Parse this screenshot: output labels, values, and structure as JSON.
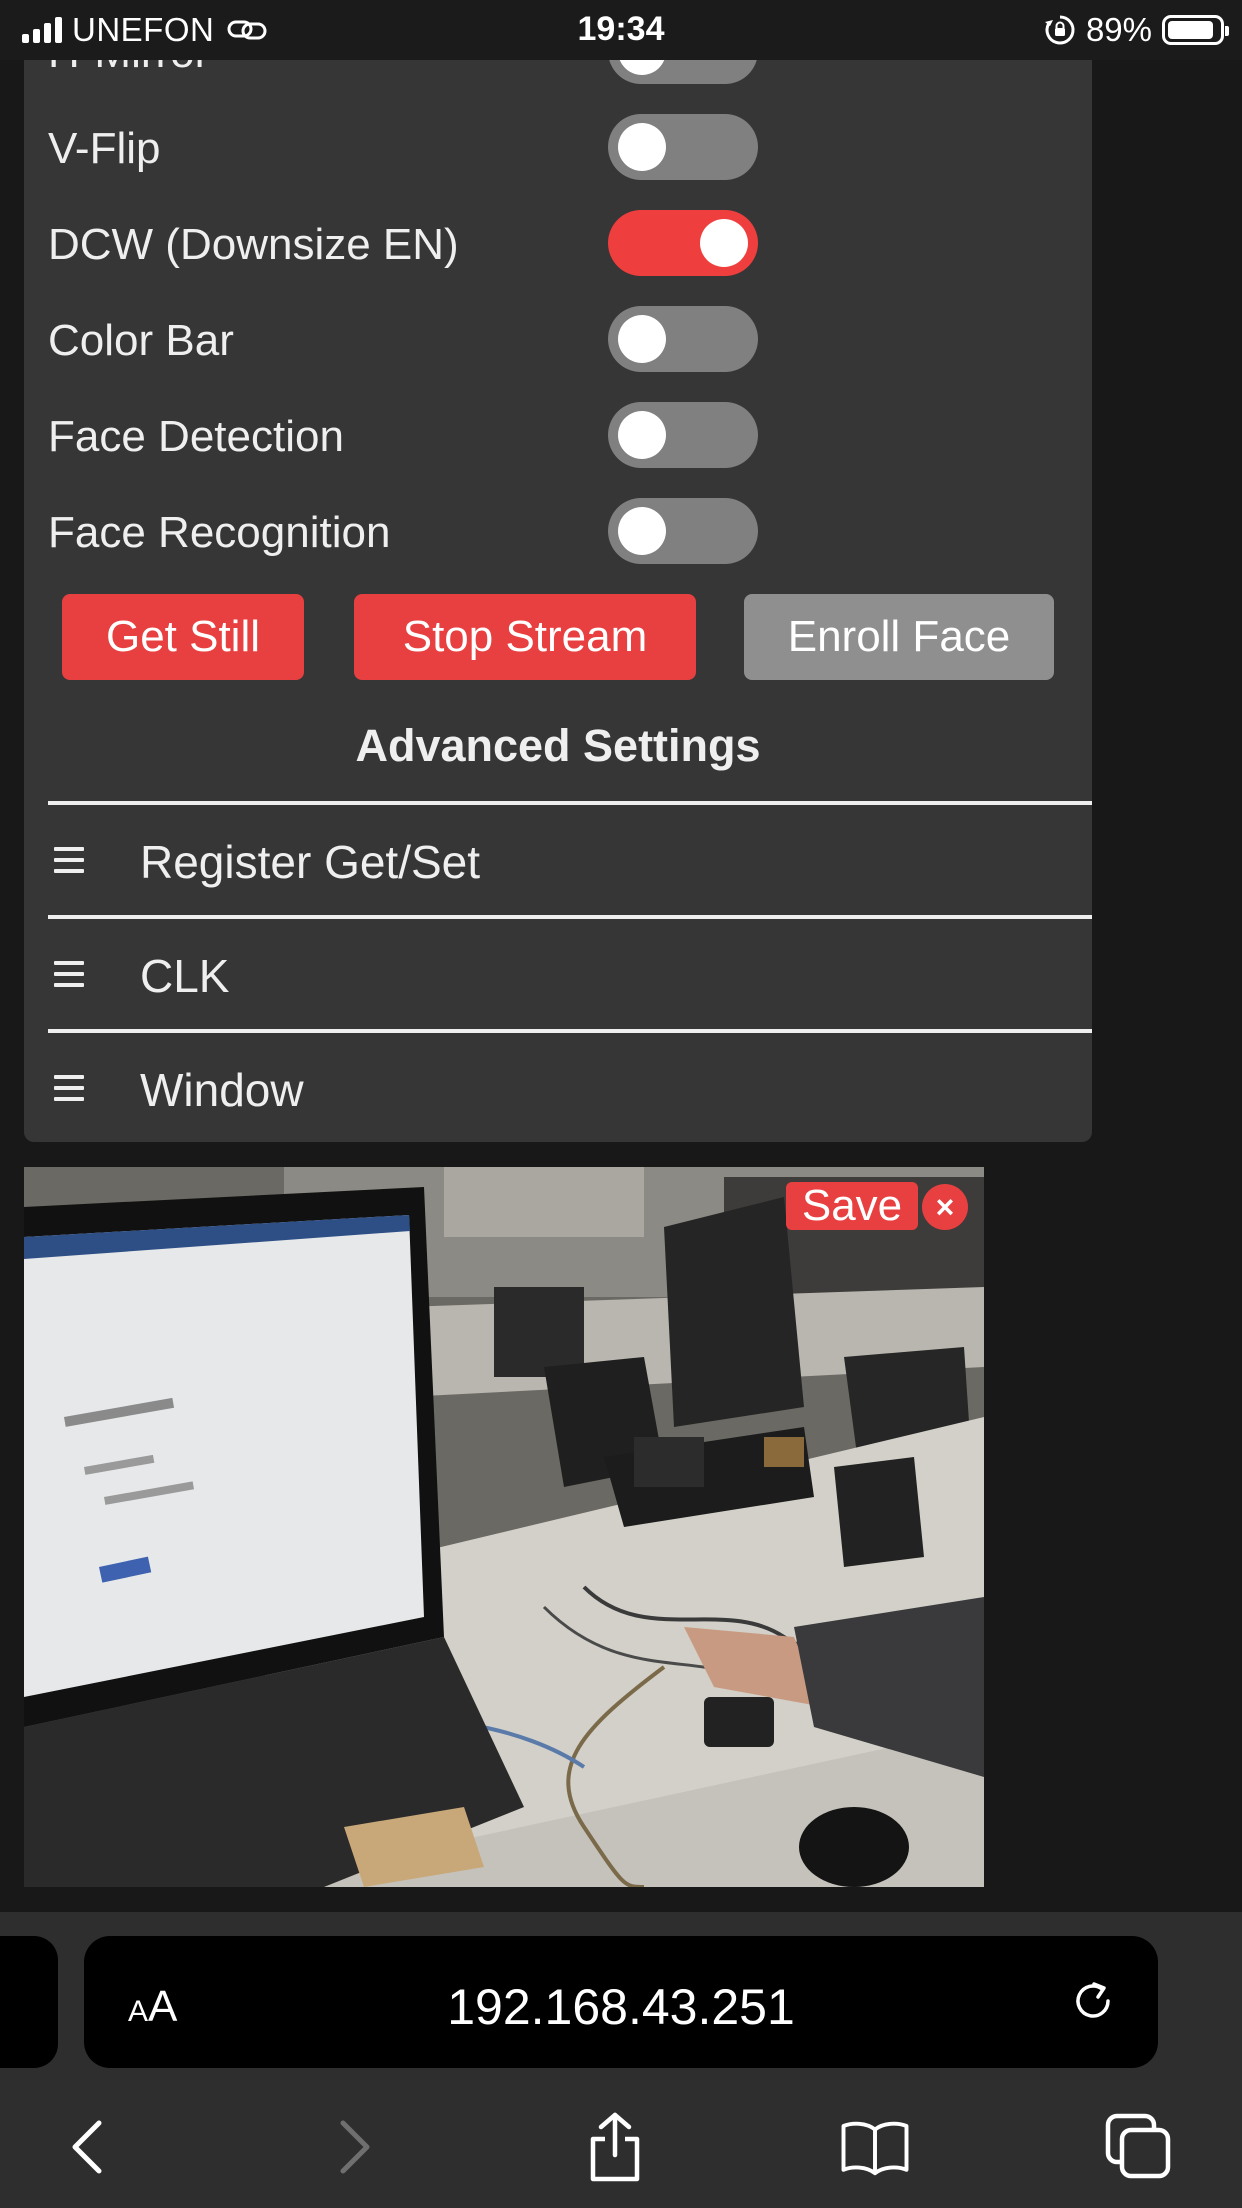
{
  "status_bar": {
    "carrier": "UNEFON",
    "time": "19:34",
    "battery": "89%",
    "battery_level": 0.89,
    "icons": [
      "signal-icon",
      "link-icon",
      "orientation-lock-icon",
      "battery-icon"
    ]
  },
  "settings": {
    "toggles": [
      {
        "label": "H-Mirror",
        "on": false
      },
      {
        "label": "V-Flip",
        "on": false
      },
      {
        "label": "DCW (Downsize EN)",
        "on": true
      },
      {
        "label": "Color Bar",
        "on": false
      },
      {
        "label": "Face Detection",
        "on": false
      },
      {
        "label": "Face Recognition",
        "on": false
      }
    ],
    "buttons": {
      "get_still": "Get Still",
      "stop_stream": "Stop Stream",
      "enroll_face": "Enroll Face"
    },
    "advanced_title": "Advanced Settings",
    "sections": [
      "Register Get/Set",
      "CLK",
      "Window"
    ]
  },
  "stream": {
    "save_label": "Save",
    "close_label": "×"
  },
  "browser": {
    "text_size_label_small": "A",
    "text_size_label_large": "A",
    "url": "192.168.43.251",
    "icons": [
      "back-icon",
      "forward-icon",
      "share-icon",
      "bookmarks-icon",
      "tabs-icon",
      "reload-icon"
    ]
  },
  "colors": {
    "accent": "#e84040",
    "panel": "#363636",
    "background": "#181818",
    "toggle_off": "#808080"
  }
}
